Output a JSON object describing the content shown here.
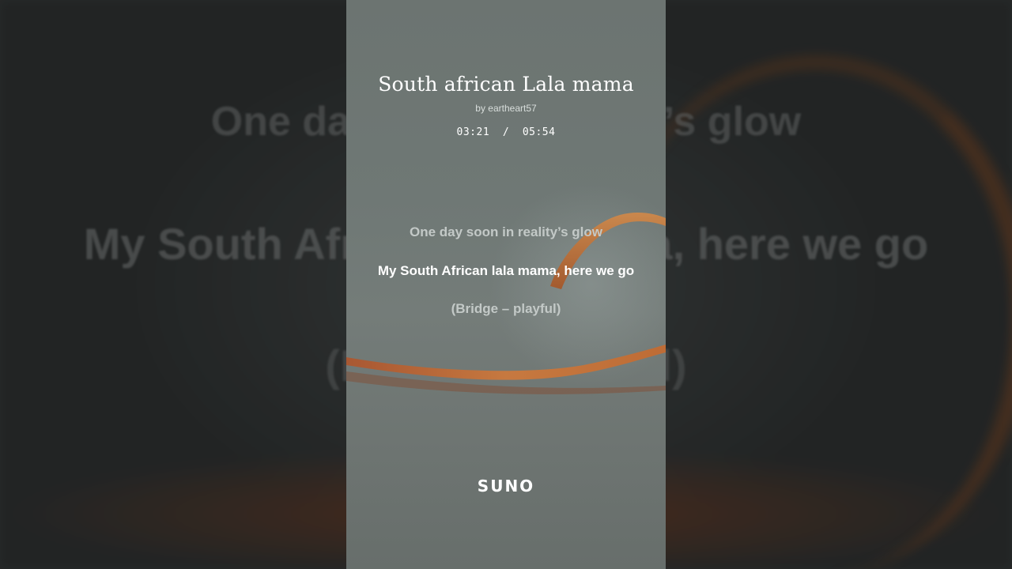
{
  "song": {
    "title": "South african Lala mama",
    "artist": "by eartheart57",
    "time": {
      "current": "03:21",
      "separator": "/",
      "total": "05:54"
    }
  },
  "lyrics": {
    "previous": "One day soon in reality’s glow",
    "current": "My South African lala mama, here we go",
    "next": "(Bridge – playful)"
  },
  "background_lyrics": {
    "line1": "One day soon in reality’s glow",
    "line2": "My South African lala mama, here we go",
    "line3": "(Bridge – playful)"
  },
  "brand": {
    "name": "SUNO"
  },
  "colors": {
    "panel": "#6f7875",
    "accent_ribbon": "#c8773a",
    "text_primary": "#ffffff",
    "text_muted": "#c3c9c7"
  }
}
